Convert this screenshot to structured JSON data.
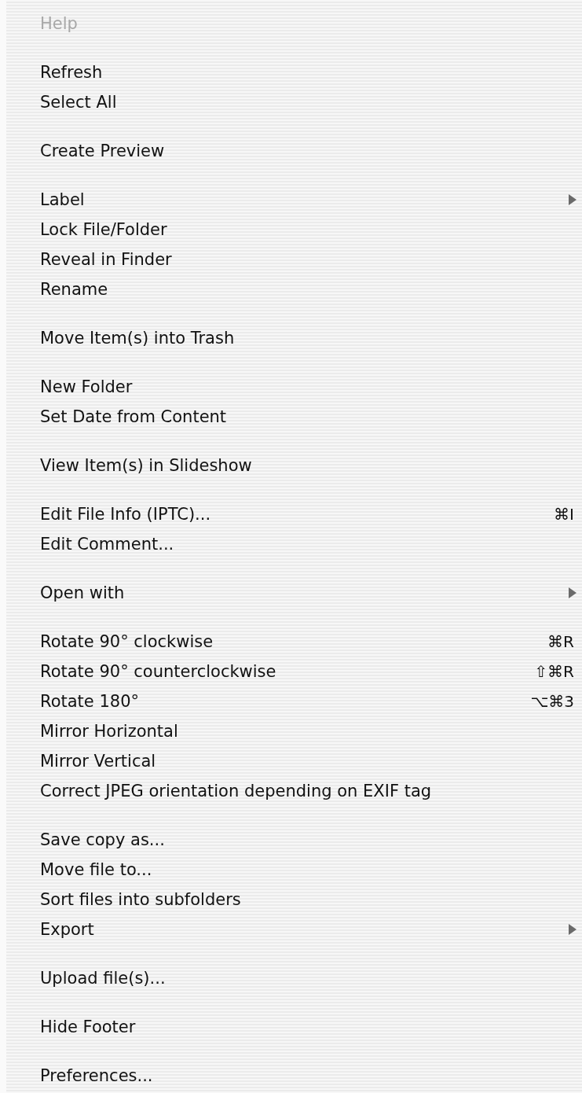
{
  "menu": {
    "groups": [
      {
        "items": [
          {
            "label": "Help",
            "disabled": true,
            "submenu": false
          }
        ]
      },
      {
        "items": [
          {
            "label": "Refresh",
            "disabled": false,
            "submenu": false
          },
          {
            "label": "Select All",
            "disabled": false,
            "submenu": false
          }
        ]
      },
      {
        "items": [
          {
            "label": "Create Preview",
            "disabled": false,
            "submenu": false
          }
        ]
      },
      {
        "items": [
          {
            "label": "Label",
            "disabled": false,
            "submenu": true
          },
          {
            "label": "Lock File/Folder",
            "disabled": false,
            "submenu": false
          },
          {
            "label": "Reveal in Finder",
            "disabled": false,
            "submenu": false
          },
          {
            "label": "Rename",
            "disabled": false,
            "submenu": false
          }
        ]
      },
      {
        "items": [
          {
            "label": "Move Item(s) into Trash",
            "disabled": false,
            "submenu": false
          }
        ]
      },
      {
        "items": [
          {
            "label": "New Folder",
            "disabled": false,
            "submenu": false
          },
          {
            "label": "Set Date from Content",
            "disabled": false,
            "submenu": false
          }
        ]
      },
      {
        "items": [
          {
            "label": "View Item(s) in Slideshow",
            "disabled": false,
            "submenu": false
          }
        ]
      },
      {
        "items": [
          {
            "label": "Edit File Info (IPTC)...",
            "disabled": false,
            "submenu": false,
            "shortcut": "⌘I"
          },
          {
            "label": "Edit Comment...",
            "disabled": false,
            "submenu": false
          }
        ]
      },
      {
        "items": [
          {
            "label": "Open with",
            "disabled": false,
            "submenu": true
          }
        ]
      },
      {
        "items": [
          {
            "label": "Rotate 90° clockwise",
            "disabled": false,
            "submenu": false,
            "shortcut": "⌘R"
          },
          {
            "label": "Rotate 90° counterclockwise",
            "disabled": false,
            "submenu": false,
            "shortcut": "⇧⌘R"
          },
          {
            "label": "Rotate 180°",
            "disabled": false,
            "submenu": false,
            "shortcut": "⌥⌘3"
          },
          {
            "label": "Mirror Horizontal",
            "disabled": false,
            "submenu": false
          },
          {
            "label": "Mirror Vertical",
            "disabled": false,
            "submenu": false
          },
          {
            "label": "Correct JPEG orientation depending on EXIF tag",
            "disabled": false,
            "submenu": false
          }
        ]
      },
      {
        "items": [
          {
            "label": "Save copy as...",
            "disabled": false,
            "submenu": false
          },
          {
            "label": "Move file to...",
            "disabled": false,
            "submenu": false
          },
          {
            "label": "Sort files into subfolders",
            "disabled": false,
            "submenu": false
          },
          {
            "label": "Export",
            "disabled": false,
            "submenu": true
          }
        ]
      },
      {
        "items": [
          {
            "label": "Upload file(s)...",
            "disabled": false,
            "submenu": false
          }
        ]
      },
      {
        "items": [
          {
            "label": "Hide Footer",
            "disabled": false,
            "submenu": false
          }
        ]
      },
      {
        "items": [
          {
            "label": "Preferences...",
            "disabled": false,
            "submenu": false
          }
        ]
      }
    ]
  }
}
